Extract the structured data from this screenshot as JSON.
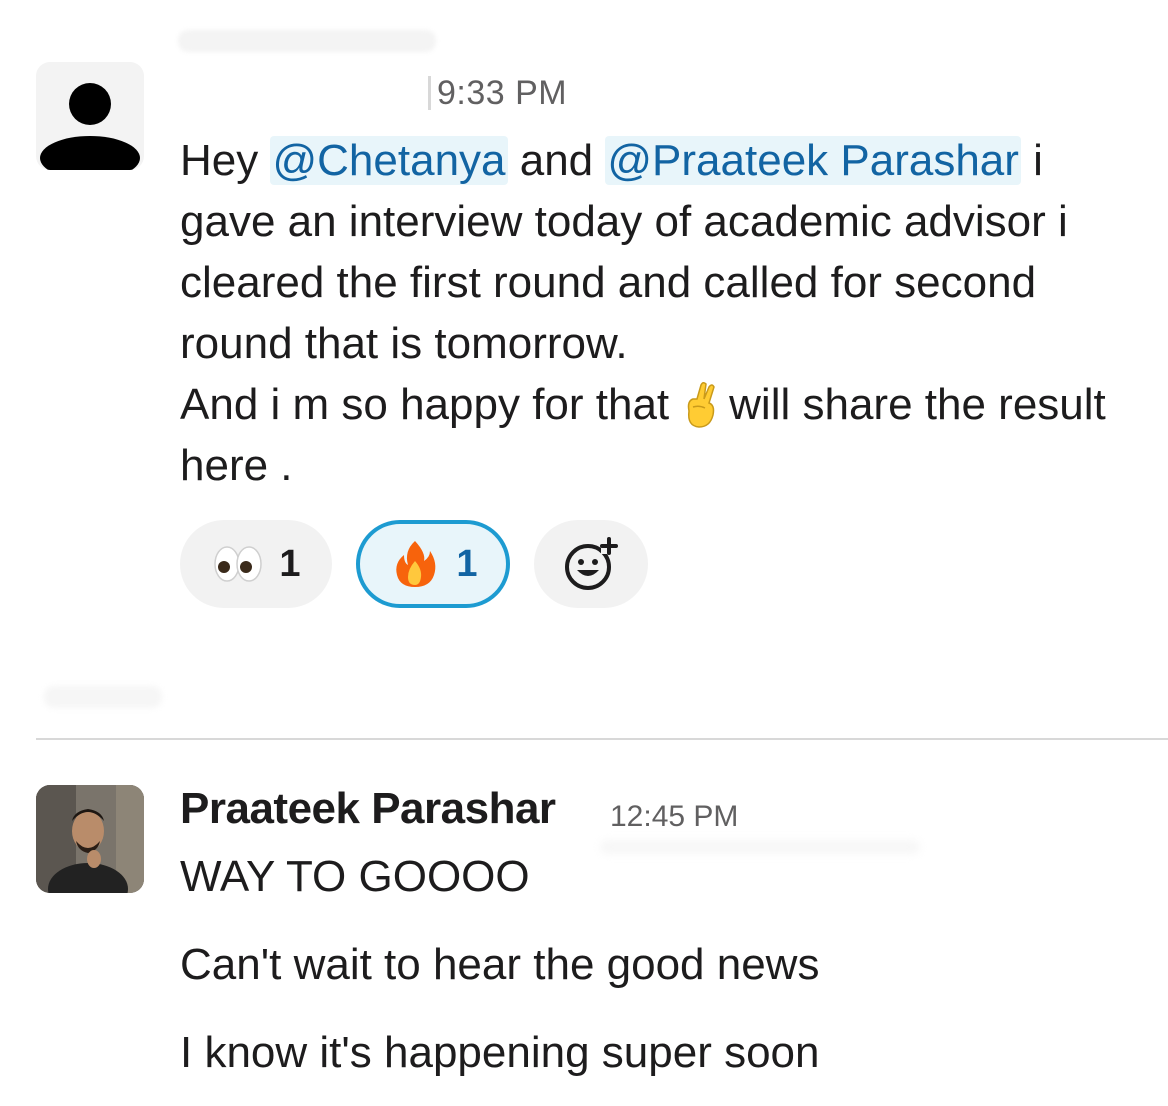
{
  "message1": {
    "timestamp": "9:33 PM",
    "avatar_icon": "default-user-avatar-icon",
    "text_before_mention1": "Hey ",
    "mention1": "@Chetanya",
    "text_between_mentions": " and ",
    "mention2": "@Praateek Parashar",
    "text_after_mention2": "  i gave an interview today of academic advisor i cleared the first round and called for second round that is tomorrow.",
    "line2_before_emoji": "And i m so happy for that",
    "inline_emoji": "crossed-fingers-emoji",
    "line2_after_emoji": "will share the result here ."
  },
  "reactions": [
    {
      "emoji": "eyes-emoji",
      "count": "1",
      "active": false
    },
    {
      "emoji": "fire-emoji",
      "count": "1",
      "active": true
    }
  ],
  "add_reaction_icon": "add-reaction-icon",
  "colors": {
    "mention_text": "#1264a3",
    "mention_bg": "#e8f5fa",
    "active_reaction_border": "#1d9bd1",
    "divider": "#d8d8d8"
  },
  "message2": {
    "sender": "Praateek Parashar",
    "timestamp": "12:45 PM",
    "avatar_icon": "user-photo-avatar",
    "lines": [
      "WAY TO GOOOO",
      "Can't wait to hear the good news",
      "I know it's happening super soon"
    ]
  }
}
